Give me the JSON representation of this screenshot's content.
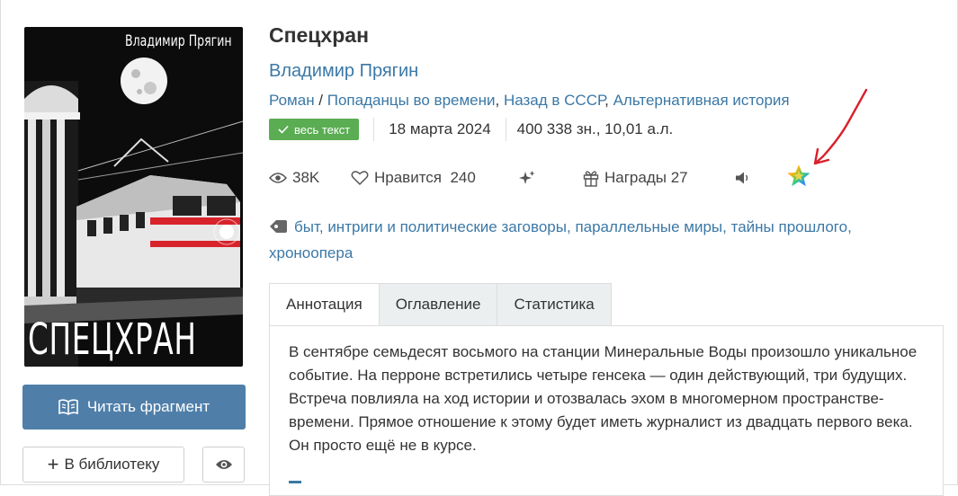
{
  "cover": {
    "author_text": "Владимир Прягин",
    "title_text": "СПЕЦХРАН"
  },
  "left_actions": {
    "read_label": "Читать фрагмент",
    "library_label": "В библиотеку"
  },
  "book": {
    "title": "Спецхран",
    "author": "Владимир Прягин",
    "genre_main": "Роман",
    "genre_sep": " / ",
    "genres": [
      "Попаданцы во времени",
      "Назад в СССР",
      "Альтернативная история"
    ],
    "status_badge": "весь текст",
    "date": "18 марта 2024",
    "size": "400 338 зн., 10,01 а.л."
  },
  "stats": {
    "views": "38K",
    "likes_label": "Нравится",
    "likes_count": "240",
    "awards_label": "Награды",
    "awards_count": "27"
  },
  "tags": [
    "быт",
    "интриги и политические заговоры",
    "параллельные миры",
    "тайны прошлого",
    "хроноопера"
  ],
  "tabs": [
    "Аннотация",
    "Оглавление",
    "Статистика"
  ],
  "annotation": "В сентябре семьдесят восьмого на станции Минеральные Воды произошло уникальное событие. На перроне встретились четыре генсека — один действующий, три будущих. Встреча повлияла на ход истории и отозвалась эхом в многомерном пространстве-времени. Прямое отношение к этому будет иметь журналист из двадцать первого века. Он просто ещё не в курсе.",
  "colors": {
    "link": "#3b78a6",
    "primary_button": "#4f7fa9",
    "badge": "#5aad52",
    "annotation_arrow": "#d9202a"
  },
  "icons": [
    "eye-icon",
    "heart-icon",
    "sparkles-icon",
    "gift-icon",
    "speaker-icon",
    "rainbow-star-icon",
    "tag-icon",
    "book-icon",
    "plus-icon",
    "check-icon"
  ]
}
